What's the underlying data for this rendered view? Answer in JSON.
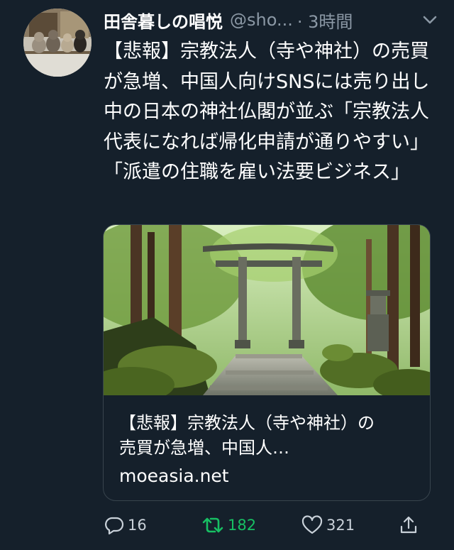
{
  "author": {
    "display_name": "田舎暮しの唱悦",
    "handle": "@sho...",
    "time": "· 3時間"
  },
  "tweet": {
    "text": "【悲報】宗教法人（寺や神社）の売買が急増、中国人向けSNSには売り出し中の日本の神社仏閣が並ぶ「宗教法人代表になれば帰化申請が通りやすい」「派遣の住職を雇い法要ビジネス」"
  },
  "card": {
    "title": "【悲報】宗教法人（寺や神社）の売買が急増、中国人…",
    "domain": "moeasia.net"
  },
  "actions": {
    "reply_count": "16",
    "retweet_count": "182",
    "like_count": "321"
  },
  "colors": {
    "background": "#15202b",
    "retweet_active": "#17bf63",
    "secondary_text": "#8b98a5",
    "card_border": "#38444d"
  }
}
